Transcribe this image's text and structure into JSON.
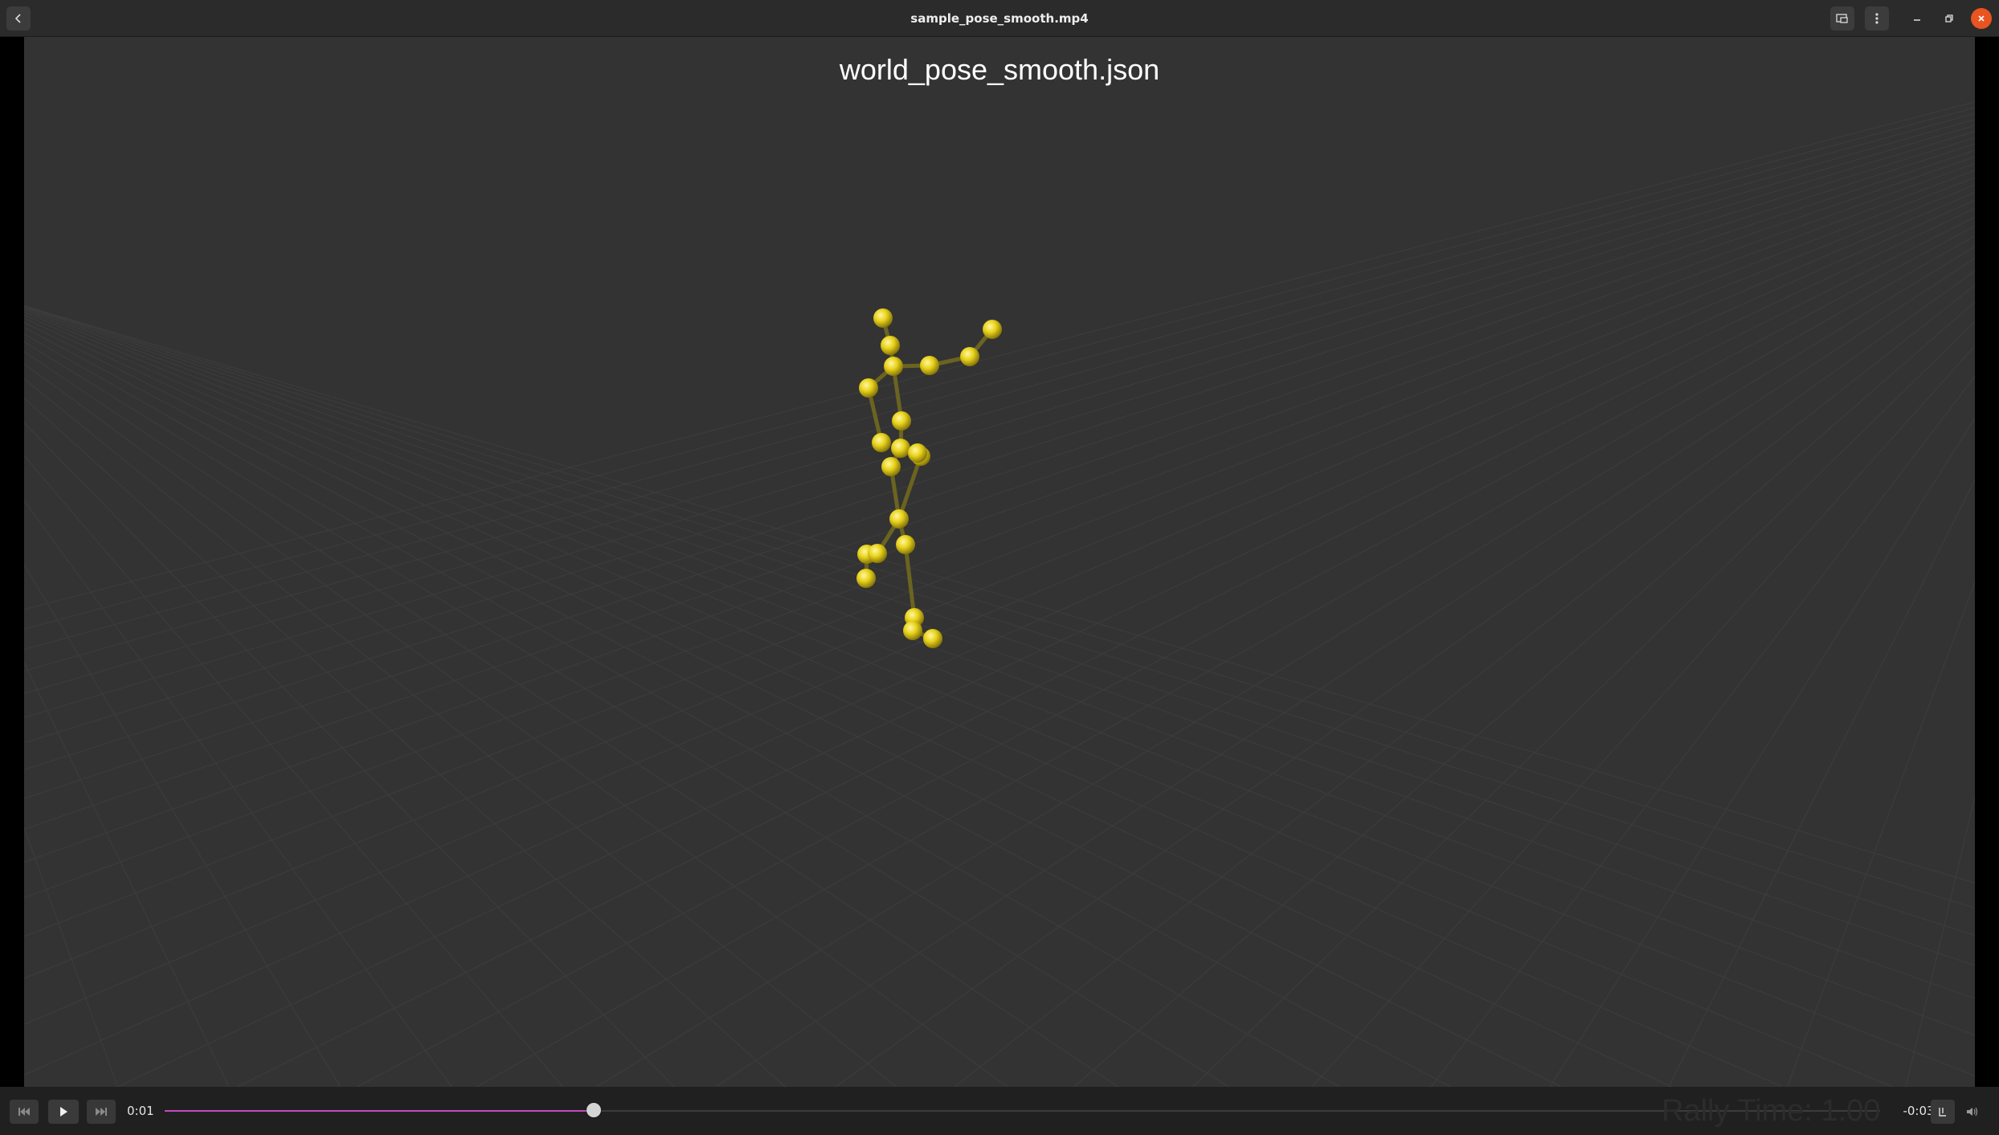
{
  "window": {
    "title": "sample_pose_smooth.mp4",
    "icons": {
      "back": "chevron-left-icon",
      "pip": "picture-in-picture-icon",
      "menu": "kebab-menu-icon",
      "minimize": "minimize-icon",
      "restore": "restore-icon",
      "close": "close-icon"
    },
    "close_color": "#e95420"
  },
  "video": {
    "scene_title": "world_pose_smooth.json",
    "background": "#333333",
    "joint_color": "#e8d21a",
    "bone_color": "#6b6420",
    "grid_color": "#3d3d3d"
  },
  "controls": {
    "elapsed": "0:01",
    "remaining": "-0:03",
    "progress": 0.25,
    "seek_color": "#c34bc0",
    "overlay_text": "Rally Time: 1.00",
    "icons": {
      "skip_back": "skip-previous-icon",
      "play": "play-icon",
      "skip_forward": "skip-next-icon",
      "subtitles": "subtitles-icon",
      "volume": "volume-icon"
    }
  }
}
